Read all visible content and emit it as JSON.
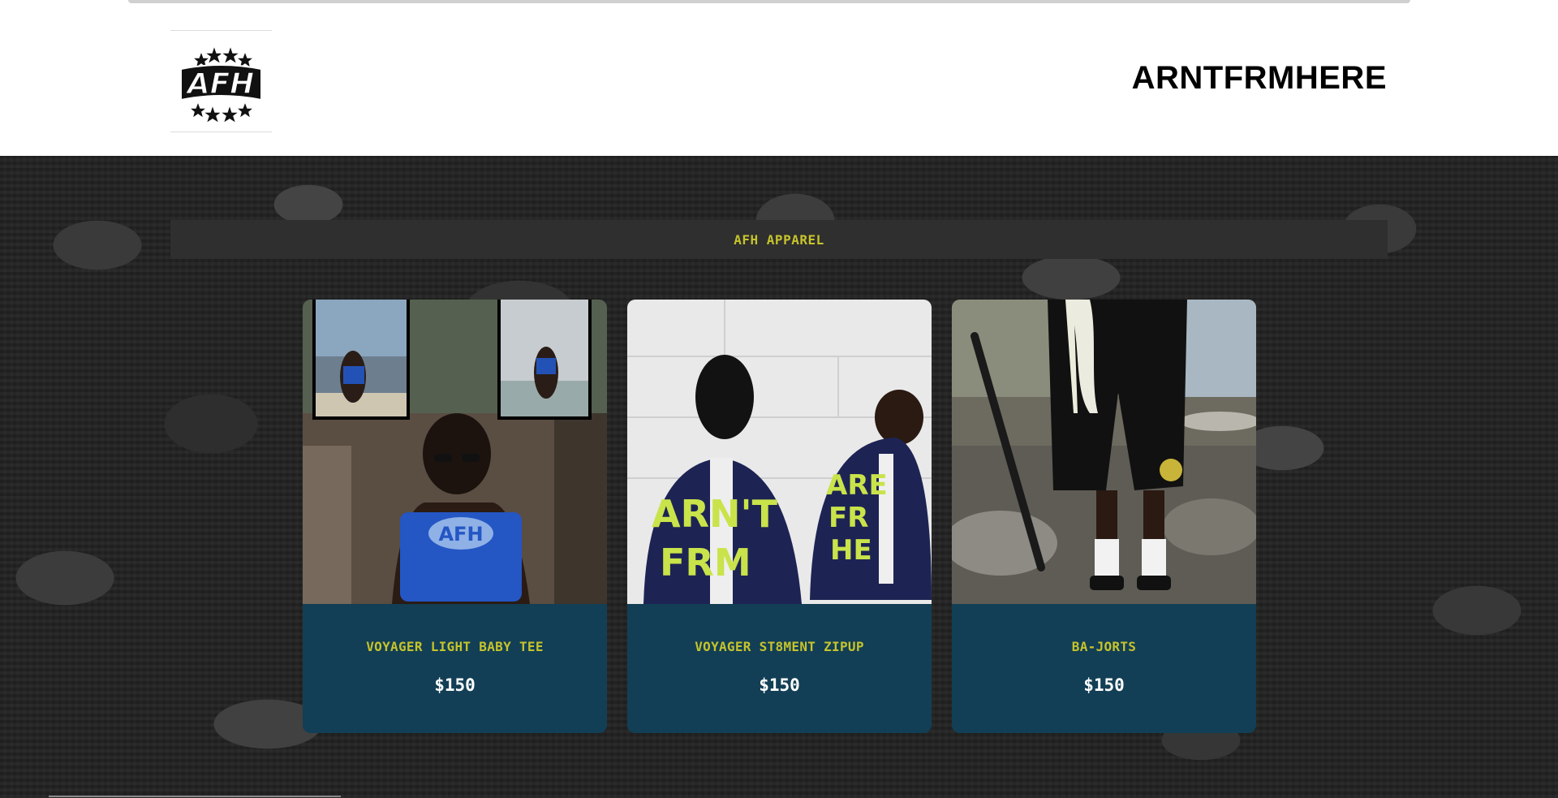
{
  "header": {
    "logo_text": "AFH",
    "brand": "ARNTFRMHERE"
  },
  "category": {
    "title": "AFH APPAREL"
  },
  "products": [
    {
      "name": "VOYAGER LIGHT BABY TEE",
      "price": "$150",
      "image": "model-blue-crop-tee-photo"
    },
    {
      "name": "VOYAGER ST8MENT ZIPUP",
      "price": "$150",
      "image": "two-models-navy-zipup-photo"
    },
    {
      "name": "BA-JORTS",
      "price": "$150",
      "image": "black-jorts-photo"
    }
  ],
  "colors": {
    "accent_yellow": "#c6c32c",
    "card_teal": "#123f55",
    "bar_gray": "#2f2f2f",
    "header_bg": "#ffffff"
  }
}
